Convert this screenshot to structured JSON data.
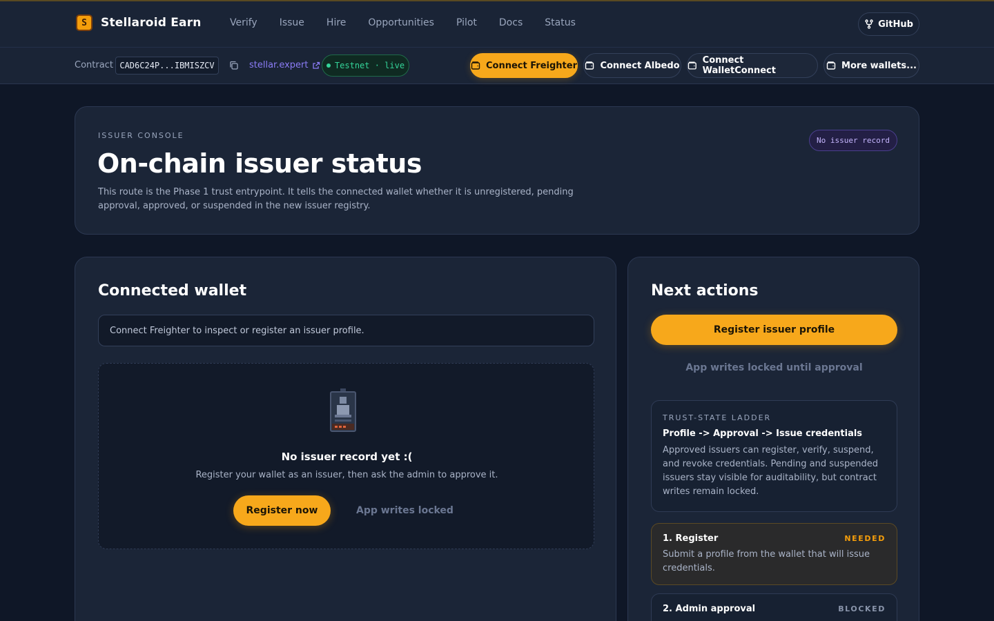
{
  "brand": {
    "name": "Stellaroid Earn",
    "logo_glyph": "S"
  },
  "nav": {
    "items": [
      "Verify",
      "Issue",
      "Hire",
      "Opportunities",
      "Pilot",
      "Docs",
      "Status"
    ]
  },
  "github": {
    "label": "GitHub",
    "icon": "github-icon"
  },
  "contract": {
    "label": "Contract",
    "id": "CAD6C24P...IBMISZCV",
    "explorer": "stellar.expert",
    "network": "Testnet · live"
  },
  "wallets": {
    "freighter": "Connect Freighter",
    "albedo": "Connect Albedo",
    "walletconnect": "Connect WalletConnect",
    "more": "More wallets..."
  },
  "hero": {
    "eyebrow": "ISSUER CONSOLE",
    "title": "On-chain issuer status",
    "description": "This route is the Phase 1 trust entrypoint. It tells the connected wallet whether it is unregistered, pending approval, approved, or suspended in the new issuer registry.",
    "badge": "No issuer record"
  },
  "wallet_panel": {
    "title": "Connected wallet",
    "hint": "Connect Freighter to inspect or register an issuer profile.",
    "empty_title": "No issuer record yet :(",
    "empty_sub": "Register your wallet as an issuer, then ask the admin to approve it.",
    "register_now": "Register now",
    "writes_locked": "App writes locked"
  },
  "actions_panel": {
    "title": "Next actions",
    "register_profile": "Register issuer profile",
    "approval_lock": "App writes locked until approval",
    "ladder": {
      "eyebrow": "TRUST-STATE LADDER",
      "title": "Profile -> Approval -> Issue credentials",
      "body": "Approved issuers can register, verify, suspend, and revoke credentials. Pending and suspended issuers stay visible for auditability, but contract writes remain locked."
    },
    "steps": [
      {
        "title": "1. Register",
        "status": "NEEDED",
        "body": "Submit a profile from the wallet that will issue credentials."
      },
      {
        "title": "2. Admin approval",
        "status": "BLOCKED",
        "body": ""
      }
    ]
  },
  "colors": {
    "accent": "#f7a81b",
    "background": "#0f1727",
    "card": "#1b2537",
    "success": "#34d399",
    "violet": "#8b7cf6"
  }
}
